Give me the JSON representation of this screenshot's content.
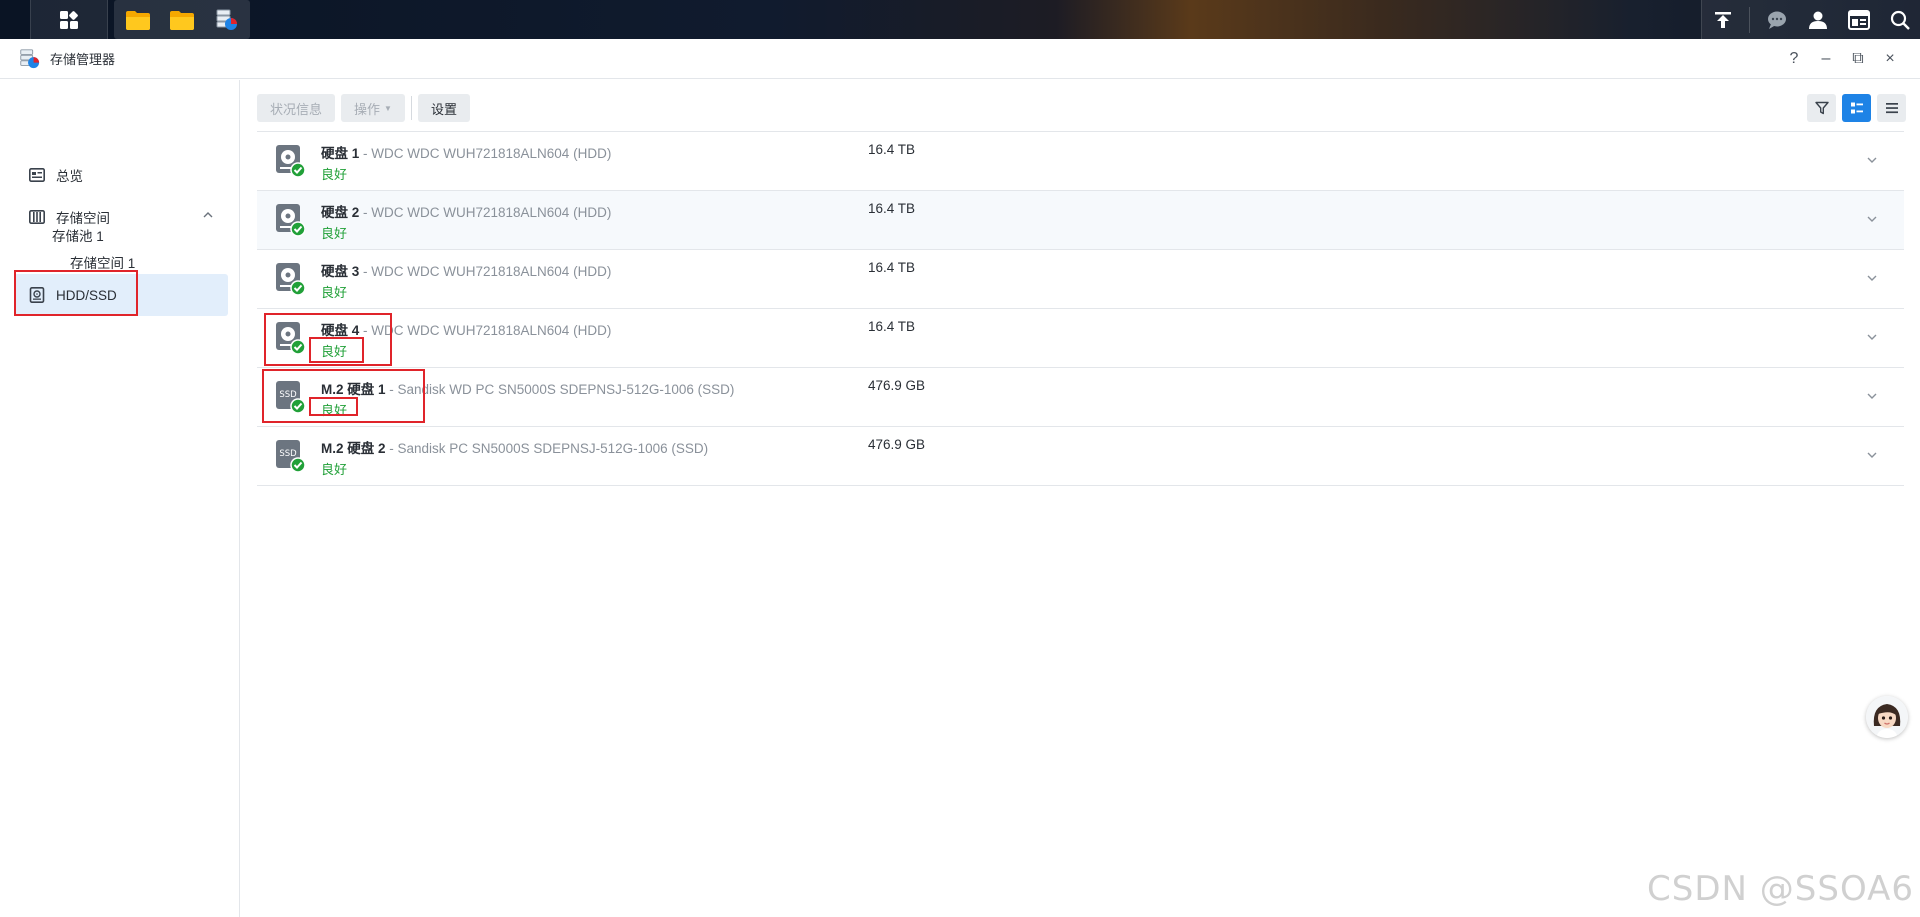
{
  "window": {
    "title": "存储管理器",
    "controls": {
      "help": "?",
      "minimize": "–",
      "restore": "⧉",
      "close": "×"
    }
  },
  "sidebar": {
    "overview": "总览",
    "storage": "存储空间",
    "pool": "存储池 1",
    "volume": "存储空间 1",
    "hdd": "HDD/SSD"
  },
  "toolbar": {
    "status_info": "状况信息",
    "action": "操作",
    "settings": "设置"
  },
  "disks": [
    {
      "name": "硬盘 1",
      "model": " - WDC WDC WUH721818ALN604 (HDD)",
      "status": "良好",
      "size": "16.4 TB",
      "kind": "HDD"
    },
    {
      "name": "硬盘 2",
      "model": " - WDC WDC WUH721818ALN604 (HDD)",
      "status": "良好",
      "size": "16.4 TB",
      "kind": "HDD"
    },
    {
      "name": "硬盘 3",
      "model": " - WDC WDC WUH721818ALN604 (HDD)",
      "status": "良好",
      "size": "16.4 TB",
      "kind": "HDD"
    },
    {
      "name": "硬盘 4",
      "model": " - WDC WDC WUH721818ALN604 (HDD)",
      "status": "良好",
      "size": "16.4 TB",
      "kind": "HDD"
    },
    {
      "name": "M.2 硬盘 1",
      "model": " - Sandisk WD PC SN5000S SDEPNSJ-512G-1006 (SSD)",
      "status": "良好",
      "size": "476.9 GB",
      "kind": "SSD"
    },
    {
      "name": "M.2 硬盘 2",
      "model": " - Sandisk PC SN5000S SDEPNSJ-512G-1006 (SSD)",
      "status": "良好",
      "size": "476.9 GB",
      "kind": "SSD"
    }
  ],
  "ssd_label": "SSD",
  "watermark": "CSDN @SSOA6",
  "colors": {
    "accent": "#1e83e6",
    "ok": "#21a038",
    "highlight": "#e0242a"
  }
}
